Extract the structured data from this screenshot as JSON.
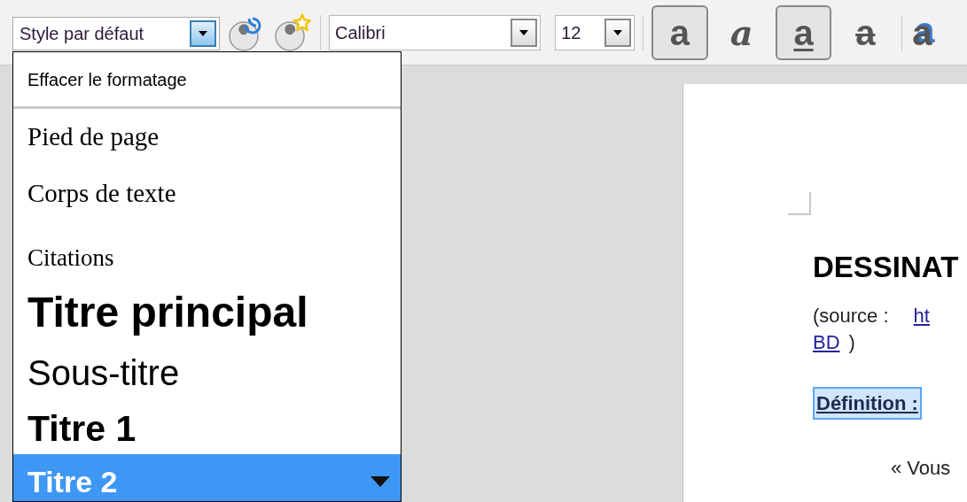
{
  "toolbar": {
    "style_box": {
      "value": "Style par défaut",
      "open": true
    },
    "font_box": {
      "value": "Calibri"
    },
    "size_box": {
      "value": "12"
    },
    "format_buttons": [
      {
        "kind": "bold",
        "glyph": "a",
        "pressed": true
      },
      {
        "kind": "italic",
        "glyph": "a",
        "pressed": false
      },
      {
        "kind": "underline",
        "glyph": "a",
        "pressed": true
      },
      {
        "kind": "strike",
        "glyph": "a",
        "pressed": false
      },
      {
        "kind": "shadow",
        "glyph": "a",
        "pressed": false
      }
    ]
  },
  "style_list": [
    {
      "label": "Effacer le formatage",
      "kind": "clear",
      "selected": false
    },
    {
      "label": "Pied de page",
      "kind": "serif",
      "selected": false
    },
    {
      "label": "Corps de texte",
      "kind": "serif",
      "selected": false
    },
    {
      "label": "Citations",
      "kind": "quote",
      "selected": false
    },
    {
      "label": "Titre principal",
      "kind": "title",
      "selected": false
    },
    {
      "label": "Sous-titre",
      "kind": "subtitle",
      "selected": false
    },
    {
      "label": "Titre 1",
      "kind": "h1",
      "selected": false
    },
    {
      "label": "Titre 2",
      "kind": "h2",
      "selected": true
    }
  ],
  "document": {
    "heading": "DESSINAT",
    "source_label": "(source :",
    "link_start": "ht",
    "link_end": "BD",
    "source_close": ")",
    "definition": "Définition :",
    "quote_start": "« Vous"
  }
}
